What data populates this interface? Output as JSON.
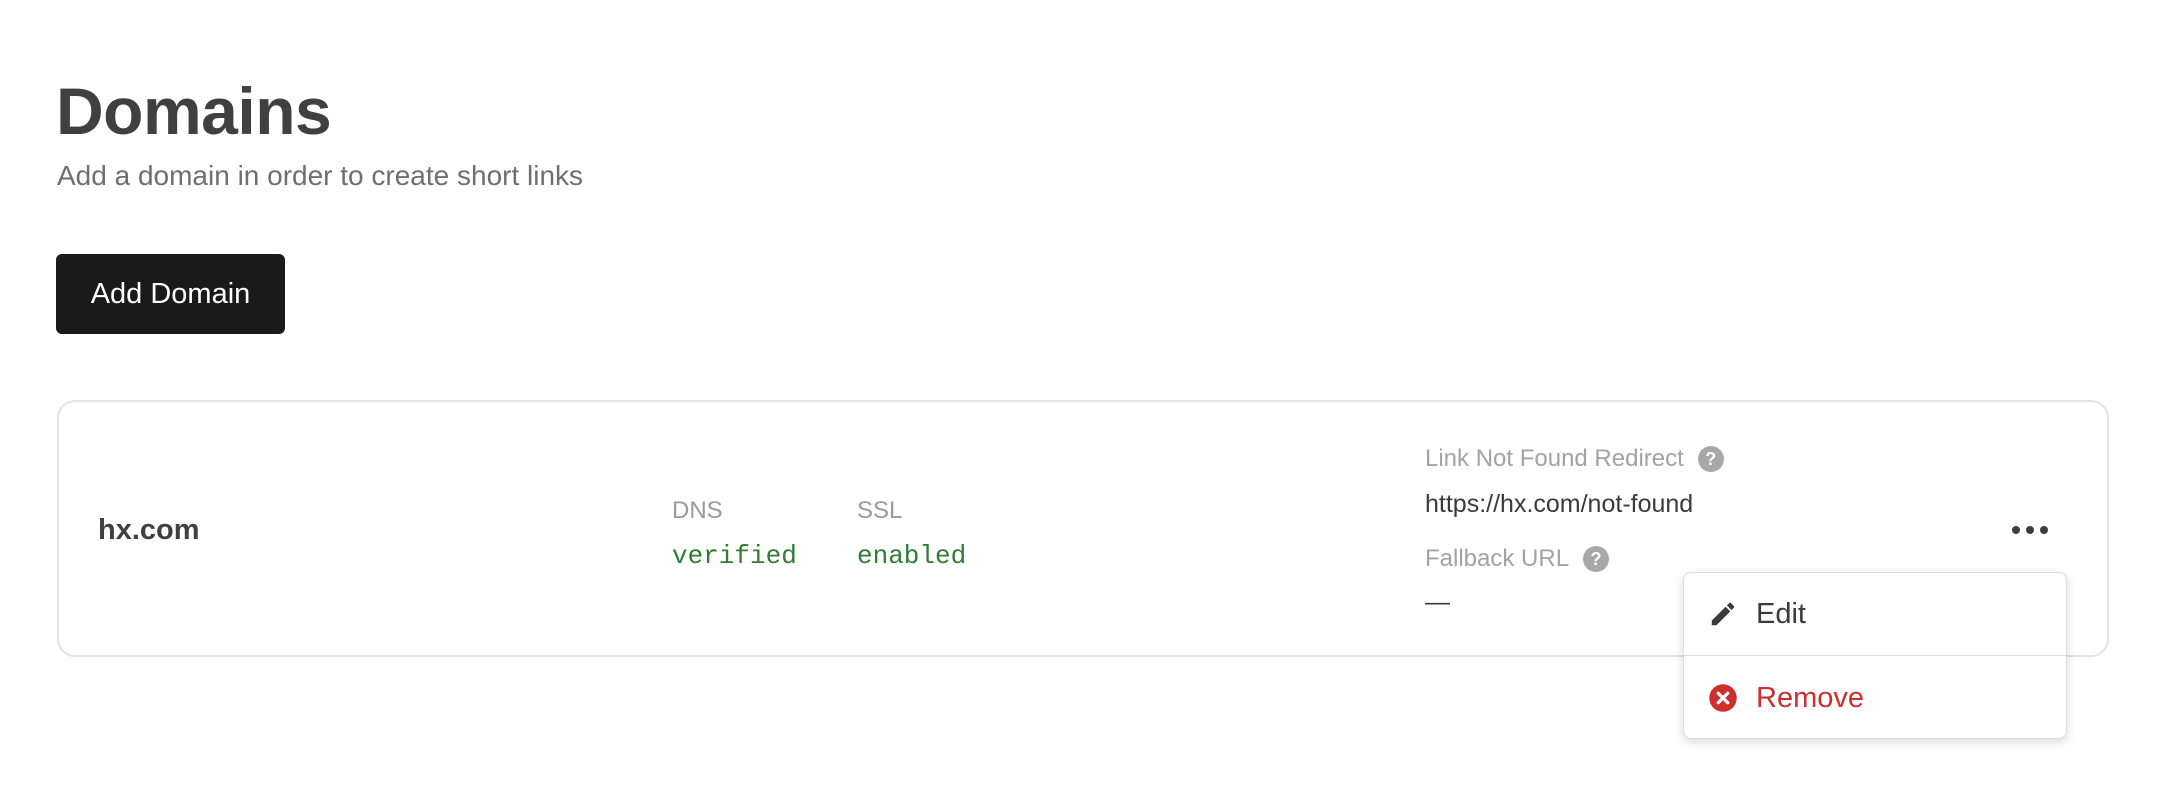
{
  "header": {
    "title": "Domains",
    "subtitle": "Add a domain in order to create short links"
  },
  "actions": {
    "add_domain_label": "Add Domain"
  },
  "domain": {
    "name": "hx.com",
    "dns": {
      "label": "DNS",
      "value": "verified"
    },
    "ssl": {
      "label": "SSL",
      "value": "enabled"
    },
    "not_found_redirect": {
      "label": "Link Not Found Redirect",
      "value": "https://hx.com/not-found",
      "help_icon": "?"
    },
    "fallback_url": {
      "label": "Fallback URL",
      "value": "—",
      "help_icon": "?"
    }
  },
  "menu": {
    "items": [
      {
        "label": "Edit",
        "icon": "pencil-icon"
      },
      {
        "label": "Remove",
        "icon": "remove-circle-icon"
      }
    ]
  },
  "colors": {
    "status_green": "#2e7d32",
    "danger_red": "#cf2e2e",
    "button_dark": "#1a1a1a"
  }
}
